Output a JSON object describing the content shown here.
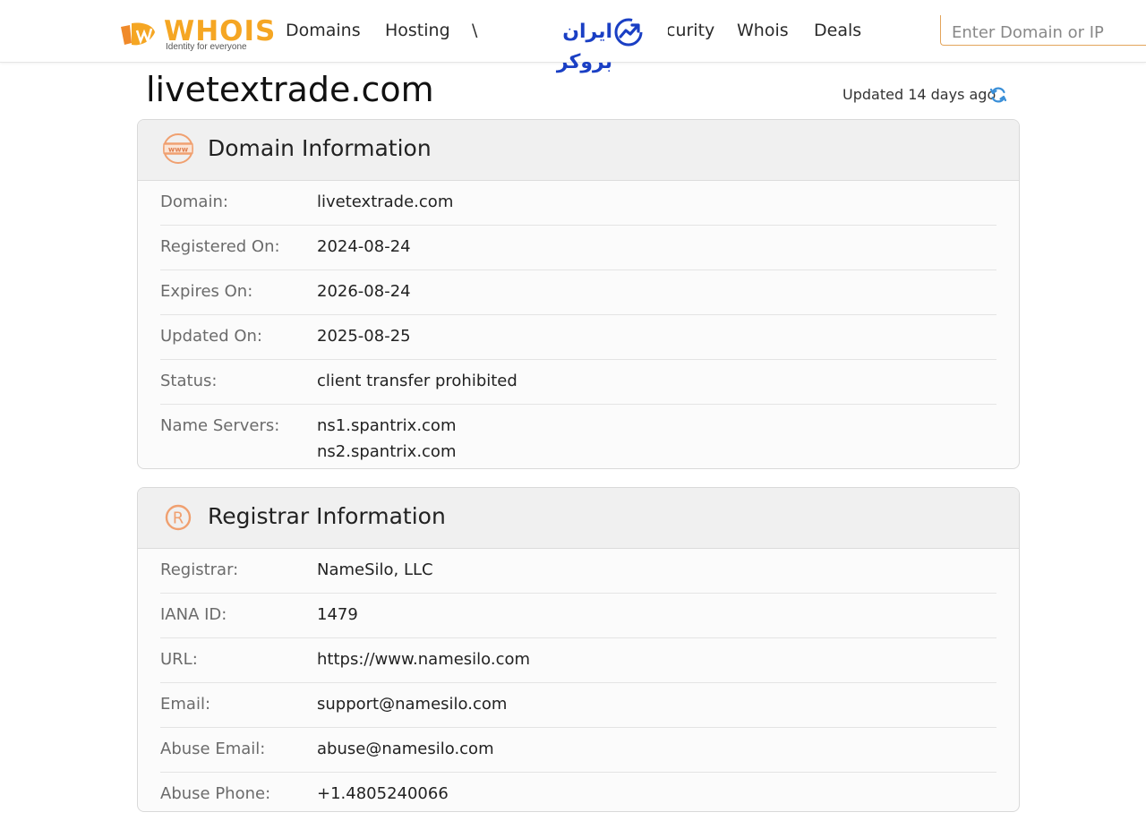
{
  "header": {
    "logo": {
      "word": "WHOIS",
      "tagline": "Identity for everyone"
    },
    "nav": [
      {
        "label": "Domains"
      },
      {
        "label": "Hosting"
      },
      {
        "label": "\\"
      },
      {
        "label": "curity"
      },
      {
        "label": "Whois"
      },
      {
        "label": "Deals"
      }
    ],
    "overlay_ad": {
      "text": "ایران بروکر"
    },
    "search": {
      "placeholder": "Enter Domain or IP",
      "value": ""
    }
  },
  "page": {
    "title": "livetextrade.com",
    "updated": "Updated 14 days ago"
  },
  "domain_info": {
    "title": "Domain Information",
    "rows": [
      {
        "label": "Domain:",
        "value": "livetextrade.com"
      },
      {
        "label": "Registered On:",
        "value": "2024-08-24"
      },
      {
        "label": "Expires On:",
        "value": "2026-08-24"
      },
      {
        "label": "Updated On:",
        "value": "2025-08-25"
      },
      {
        "label": "Status:",
        "value": "client transfer prohibited"
      },
      {
        "label": "Name Servers:",
        "value": "ns1.spantrix.com",
        "value2": "ns2.spantrix.com"
      }
    ]
  },
  "registrar_info": {
    "title": "Registrar Information",
    "rows": [
      {
        "label": "Registrar:",
        "value": "NameSilo, LLC"
      },
      {
        "label": "IANA ID:",
        "value": "1479"
      },
      {
        "label": "URL:",
        "value": "https://www.namesilo.com"
      },
      {
        "label": "Email:",
        "value": "support@namesilo.com"
      },
      {
        "label": "Abuse Email:",
        "value": "abuse@namesilo.com"
      },
      {
        "label": "Abuse Phone:",
        "value": "+1.4805240066"
      }
    ]
  },
  "colors": {
    "accent": "#f5a623",
    "icon_orange": "#f0a070",
    "ad_blue": "#1a3fc4",
    "refresh_blue": "#3a8fd8"
  }
}
